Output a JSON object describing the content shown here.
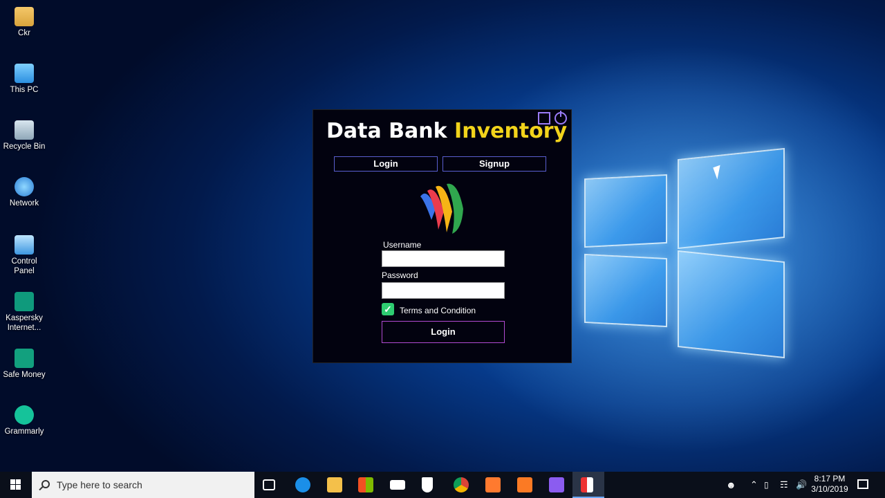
{
  "desktop": {
    "icons": [
      {
        "label": "Ckr",
        "icon": "user-folder-icon"
      },
      {
        "label": "This PC",
        "icon": "computer-icon"
      },
      {
        "label": "Recycle Bin",
        "icon": "recycle-bin-icon"
      },
      {
        "label": "Network",
        "icon": "network-icon"
      },
      {
        "label": "Control Panel",
        "icon": "control-panel-icon"
      },
      {
        "label": "Kaspersky Internet...",
        "icon": "kaspersky-icon"
      },
      {
        "label": "Safe Money",
        "icon": "safe-money-icon"
      },
      {
        "label": "Grammarly",
        "icon": "grammarly-icon"
      }
    ]
  },
  "app": {
    "title_main": "Data Bank ",
    "title_accent": "Inventory",
    "tabs": {
      "login": "Login",
      "signup": "Signup"
    },
    "form": {
      "username_label": "Username",
      "username_value": "",
      "password_label": "Password",
      "password_value": "",
      "terms_label": "Terms and Condition",
      "terms_checked": true,
      "submit_label": "Login"
    },
    "colors": {
      "accent": "#f2d31b",
      "background": "#02020f",
      "checkbox": "#2ecc71",
      "button_border": "#b14bd4"
    }
  },
  "taskbar": {
    "search_placeholder": "Type here to search",
    "pinned": [
      "task-view-icon",
      "edge-icon",
      "file-explorer-icon",
      "store-icon",
      "mail-icon",
      "security-icon",
      "chrome-icon",
      "app-icon",
      "xampp-icon",
      "visual-studio-icon",
      "active-app-icon"
    ],
    "clock_time": "8:17 PM",
    "clock_date": "3/10/2019"
  }
}
